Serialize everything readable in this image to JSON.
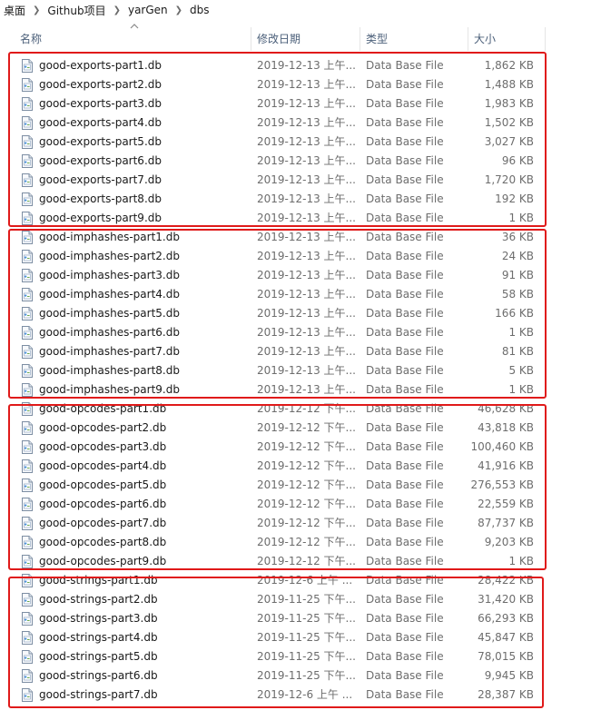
{
  "breadcrumb": [
    "桌面",
    "Github项目",
    "yarGen",
    "dbs"
  ],
  "columns": {
    "name": "名称",
    "date": "修改日期",
    "type": "类型",
    "size": "大小"
  },
  "colors": {
    "highlight": "#e01a1a",
    "header_text": "#4c607a"
  },
  "files": [
    {
      "name": "good-exports-part1.db",
      "date": "2019-12-13 上午...",
      "type": "Data Base File",
      "size": "1,862 KB"
    },
    {
      "name": "good-exports-part2.db",
      "date": "2019-12-13 上午...",
      "type": "Data Base File",
      "size": "1,488 KB"
    },
    {
      "name": "good-exports-part3.db",
      "date": "2019-12-13 上午...",
      "type": "Data Base File",
      "size": "1,983 KB"
    },
    {
      "name": "good-exports-part4.db",
      "date": "2019-12-13 上午...",
      "type": "Data Base File",
      "size": "1,502 KB"
    },
    {
      "name": "good-exports-part5.db",
      "date": "2019-12-13 上午...",
      "type": "Data Base File",
      "size": "3,027 KB"
    },
    {
      "name": "good-exports-part6.db",
      "date": "2019-12-13 上午...",
      "type": "Data Base File",
      "size": "96 KB"
    },
    {
      "name": "good-exports-part7.db",
      "date": "2019-12-13 上午...",
      "type": "Data Base File",
      "size": "1,720 KB"
    },
    {
      "name": "good-exports-part8.db",
      "date": "2019-12-13 上午...",
      "type": "Data Base File",
      "size": "192 KB"
    },
    {
      "name": "good-exports-part9.db",
      "date": "2019-12-13 上午...",
      "type": "Data Base File",
      "size": "1 KB"
    },
    {
      "name": "good-imphashes-part1.db",
      "date": "2019-12-13 上午...",
      "type": "Data Base File",
      "size": "36 KB"
    },
    {
      "name": "good-imphashes-part2.db",
      "date": "2019-12-13 上午...",
      "type": "Data Base File",
      "size": "24 KB"
    },
    {
      "name": "good-imphashes-part3.db",
      "date": "2019-12-13 上午...",
      "type": "Data Base File",
      "size": "91 KB"
    },
    {
      "name": "good-imphashes-part4.db",
      "date": "2019-12-13 上午...",
      "type": "Data Base File",
      "size": "58 KB"
    },
    {
      "name": "good-imphashes-part5.db",
      "date": "2019-12-13 上午...",
      "type": "Data Base File",
      "size": "166 KB"
    },
    {
      "name": "good-imphashes-part6.db",
      "date": "2019-12-13 上午...",
      "type": "Data Base File",
      "size": "1 KB"
    },
    {
      "name": "good-imphashes-part7.db",
      "date": "2019-12-13 上午...",
      "type": "Data Base File",
      "size": "81 KB"
    },
    {
      "name": "good-imphashes-part8.db",
      "date": "2019-12-13 上午...",
      "type": "Data Base File",
      "size": "5 KB"
    },
    {
      "name": "good-imphashes-part9.db",
      "date": "2019-12-13 上午...",
      "type": "Data Base File",
      "size": "1 KB"
    },
    {
      "name": "good-opcodes-part1.db",
      "date": "2019-12-12 下午...",
      "type": "Data Base File",
      "size": "46,628 KB"
    },
    {
      "name": "good-opcodes-part2.db",
      "date": "2019-12-12 下午...",
      "type": "Data Base File",
      "size": "43,818 KB"
    },
    {
      "name": "good-opcodes-part3.db",
      "date": "2019-12-12 下午...",
      "type": "Data Base File",
      "size": "100,460 KB"
    },
    {
      "name": "good-opcodes-part4.db",
      "date": "2019-12-12 下午...",
      "type": "Data Base File",
      "size": "41,916 KB"
    },
    {
      "name": "good-opcodes-part5.db",
      "date": "2019-12-12 下午...",
      "type": "Data Base File",
      "size": "276,553 KB"
    },
    {
      "name": "good-opcodes-part6.db",
      "date": "2019-12-12 下午...",
      "type": "Data Base File",
      "size": "22,559 KB"
    },
    {
      "name": "good-opcodes-part7.db",
      "date": "2019-12-12 下午...",
      "type": "Data Base File",
      "size": "87,737 KB"
    },
    {
      "name": "good-opcodes-part8.db",
      "date": "2019-12-12 下午...",
      "type": "Data Base File",
      "size": "9,203 KB"
    },
    {
      "name": "good-opcodes-part9.db",
      "date": "2019-12-12 下午...",
      "type": "Data Base File",
      "size": "1 KB"
    },
    {
      "name": "good-strings-part1.db",
      "date": "2019-12-6 上午 ...",
      "type": "Data Base File",
      "size": "28,422 KB"
    },
    {
      "name": "good-strings-part2.db",
      "date": "2019-11-25 下午...",
      "type": "Data Base File",
      "size": "31,420 KB"
    },
    {
      "name": "good-strings-part3.db",
      "date": "2019-11-25 下午...",
      "type": "Data Base File",
      "size": "66,293 KB"
    },
    {
      "name": "good-strings-part4.db",
      "date": "2019-11-25 下午...",
      "type": "Data Base File",
      "size": "45,847 KB"
    },
    {
      "name": "good-strings-part5.db",
      "date": "2019-11-25 下午...",
      "type": "Data Base File",
      "size": "78,015 KB"
    },
    {
      "name": "good-strings-part6.db",
      "date": "2019-11-25 下午...",
      "type": "Data Base File",
      "size": "9,945 KB"
    },
    {
      "name": "good-strings-part7.db",
      "date": "2019-12-6 上午 ...",
      "type": "Data Base File",
      "size": "28,387 KB"
    }
  ]
}
